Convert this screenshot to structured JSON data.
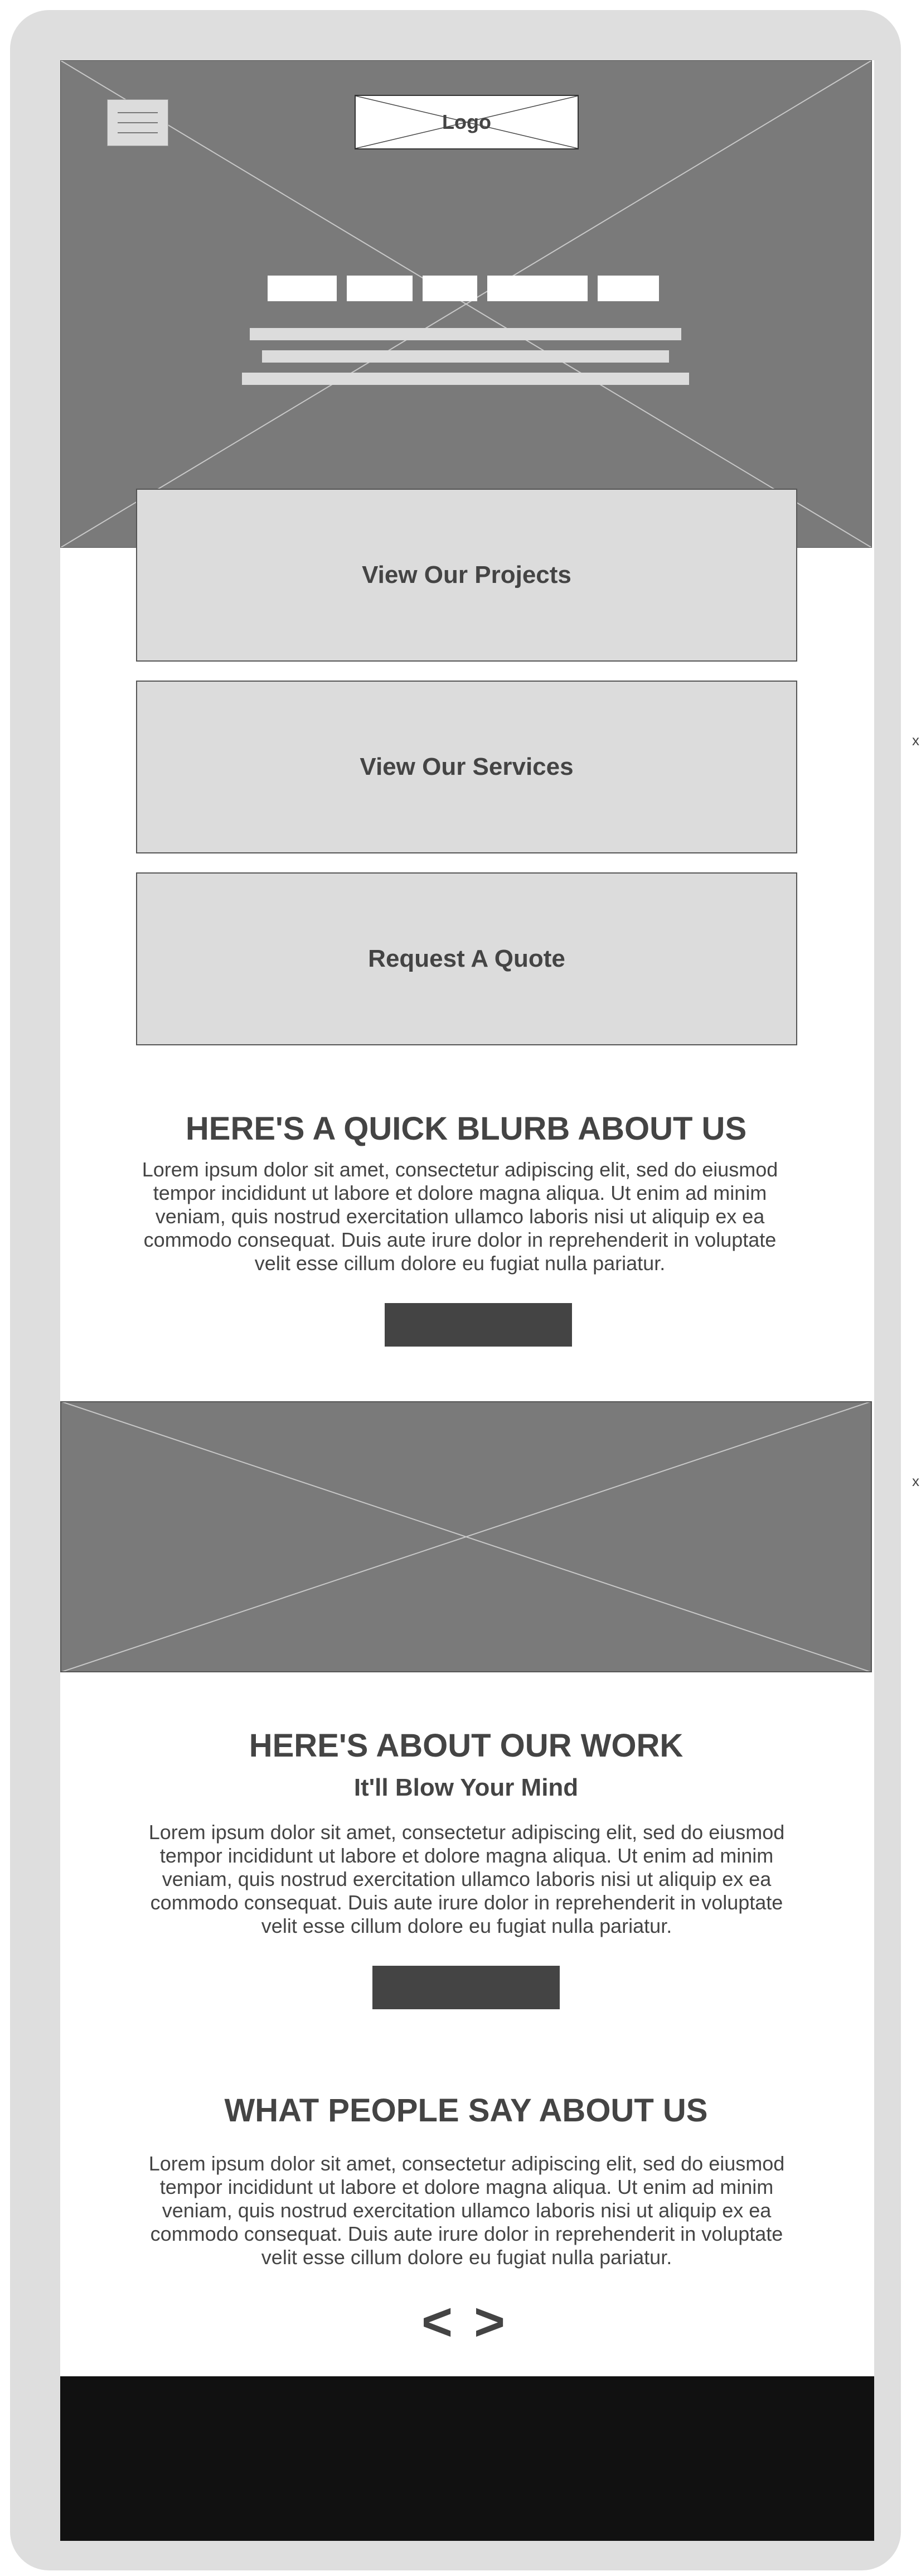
{
  "header": {
    "logo_text": "Logo",
    "menu_icon": "hamburger-menu-icon"
  },
  "cta_cards": [
    {
      "label": "View Our Projects"
    },
    {
      "label": "View Our Services"
    },
    {
      "label": "Request A Quote"
    }
  ],
  "about": {
    "heading": "HERE'S A QUICK BLURB ABOUT US",
    "body": "Lorem ipsum dolor sit amet, consectetur adipiscing elit, sed do eiusmod tempor incididunt ut labore et dolore magna aliqua. Ut enim ad minim veniam, quis nostrud exercitation ullamco laboris nisi ut aliquip ex ea commodo consequat. Duis aute irure dolor in reprehenderit in voluptate velit esse cillum dolore eu fugiat nulla pariatur."
  },
  "work": {
    "heading": "HERE'S ABOUT OUR WORK",
    "subheading": "It'll Blow Your Mind",
    "body": "Lorem ipsum dolor sit amet, consectetur adipiscing elit, sed do eiusmod tempor incididunt ut labore et dolore magna aliqua. Ut enim ad minim veniam, quis nostrud exercitation ullamco laboris nisi ut aliquip ex ea commodo consequat. Duis aute irure dolor in reprehenderit in voluptate velit esse cillum dolore eu fugiat nulla pariatur."
  },
  "testimonials": {
    "heading": "WHAT PEOPLE SAY ABOUT US",
    "body": "Lorem ipsum dolor sit amet, consectetur adipiscing elit, sed do eiusmod tempor incididunt ut labore et dolore magna aliqua. Ut enim ad minim veniam, quis nostrud exercitation ullamco laboris nisi ut aliquip ex ea commodo consequat. Duis aute irure dolor in reprehenderit in voluptate velit esse cillum dolore eu fugiat nulla pariatur.",
    "prev_label": "<",
    "next_label": ">"
  },
  "side_markers": [
    "x",
    "x"
  ],
  "colors": {
    "device_frame": "#dedede",
    "placeholder_image": "#7a7a7a",
    "card_fill": "#dcdcdc",
    "text": "#444444",
    "button": "#444444",
    "footer": "#111111"
  }
}
